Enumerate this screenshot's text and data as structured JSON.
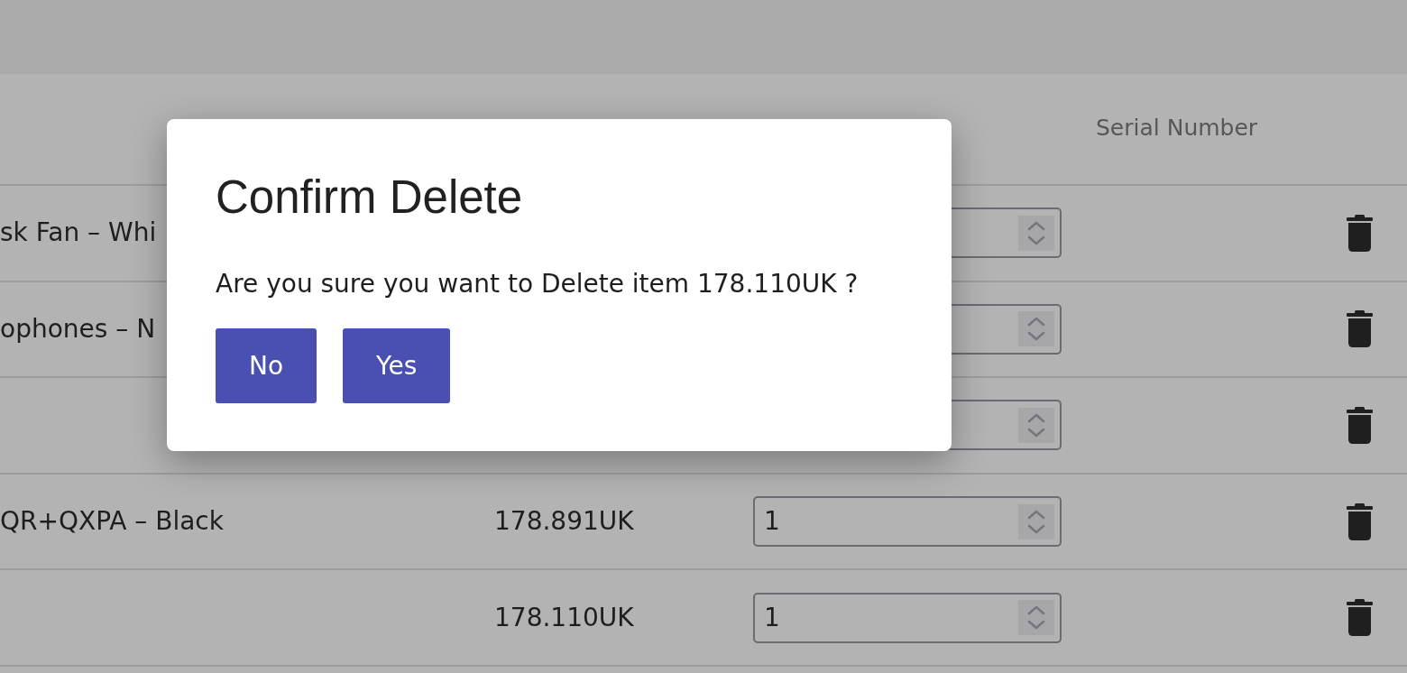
{
  "table": {
    "headings": {
      "column_4": "Serial Number"
    },
    "rows": [
      {
        "column_1": "sk Fan – Whi"
      },
      {
        "column_1": "ophones – N"
      },
      {},
      {
        "column_1": "QR+QXPA – Black",
        "column_2": "178.891UK",
        "column_3": "1"
      },
      {
        "column_2": "178.110UK",
        "column_3": "1"
      }
    ]
  },
  "dialog": {
    "title": "Confirm Delete",
    "message": "Are you sure you want to Delete item 178.110UK ?",
    "buttons": [
      {
        "label": "No"
      },
      {
        "label": "Yes"
      }
    ]
  }
}
